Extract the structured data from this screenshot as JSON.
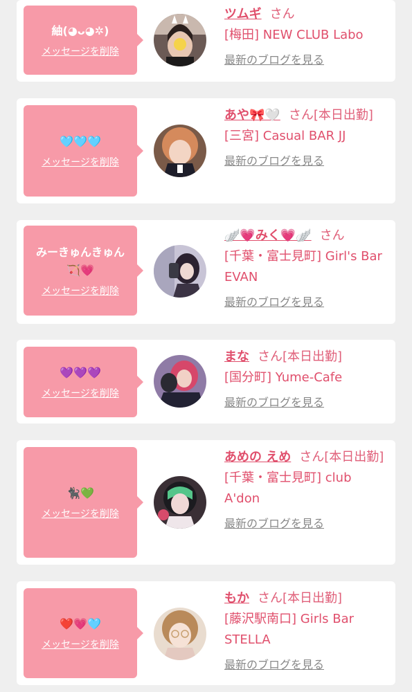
{
  "delete_label": "メッセージを削除",
  "blog_label": "最新のブログを見る",
  "san_label": "さん",
  "cards": [
    {
      "message": "紬(◕ᴗ◕✲)",
      "name": "ツムギ",
      "suffix": "さん",
      "shop": "[梅田] NEW CLUB Labo"
    },
    {
      "message": "🩵🩵🩵",
      "name": "あや🎀🤍",
      "suffix": "さん[本日出勤]",
      "shop": "[三宮] Casual BAR JJ"
    },
    {
      "message": "みーきゅんきゅん\n🏹💗",
      "name": "🪽💗みく💗🪽",
      "suffix": "さん",
      "shop": "[千葉・富士見町] Girl's Bar EVAN"
    },
    {
      "message": "💜💜💜",
      "name": "まな",
      "suffix": "さん[本日出勤]",
      "shop": "[国分町] Yume-Cafe"
    },
    {
      "message": "🐈‍⬛💚",
      "name": "あめの えめ",
      "suffix": "さん[本日出勤]",
      "shop": "[千葉・富士見町] club A'don"
    },
    {
      "message": "❤️💗🩵",
      "name": "もか",
      "suffix": "さん[本日出勤]",
      "shop": "[藤沢駅南口] Girls Bar STELLA"
    }
  ]
}
